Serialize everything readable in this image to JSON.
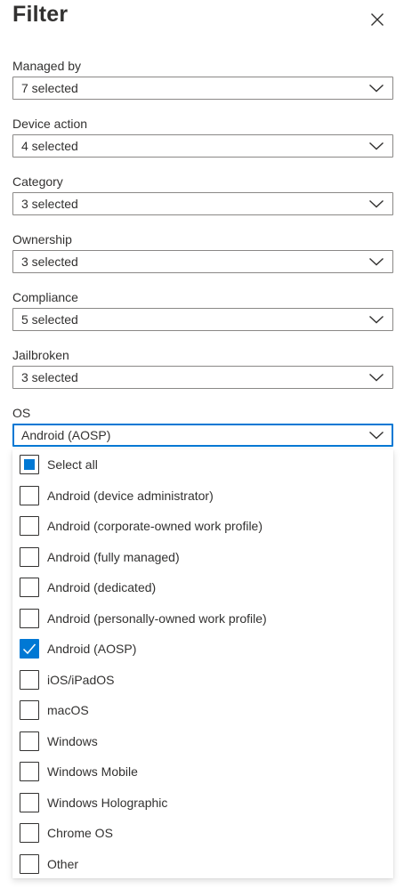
{
  "panel": {
    "title": "Filter",
    "close_icon": "close-icon"
  },
  "fields": [
    {
      "label": "Managed by",
      "value": "7 selected"
    },
    {
      "label": "Device action",
      "value": "4 selected"
    },
    {
      "label": "Category",
      "value": "3 selected"
    },
    {
      "label": "Ownership",
      "value": "3 selected"
    },
    {
      "label": "Compliance",
      "value": "5 selected"
    },
    {
      "label": "Jailbroken",
      "value": "3 selected"
    },
    {
      "label": "OS",
      "value": "Android (AOSP)",
      "open": true
    }
  ],
  "os_options": [
    {
      "label": "Select all",
      "state": "indeterminate"
    },
    {
      "label": "Android (device administrator)",
      "state": "unchecked"
    },
    {
      "label": "Android (corporate-owned work profile)",
      "state": "unchecked"
    },
    {
      "label": "Android (fully managed)",
      "state": "unchecked"
    },
    {
      "label": "Android (dedicated)",
      "state": "unchecked"
    },
    {
      "label": "Android (personally-owned work profile)",
      "state": "unchecked"
    },
    {
      "label": "Android (AOSP)",
      "state": "checked"
    },
    {
      "label": "iOS/iPadOS",
      "state": "unchecked"
    },
    {
      "label": "macOS",
      "state": "unchecked"
    },
    {
      "label": "Windows",
      "state": "unchecked"
    },
    {
      "label": "Windows Mobile",
      "state": "unchecked"
    },
    {
      "label": "Windows Holographic",
      "state": "unchecked"
    },
    {
      "label": "Chrome OS",
      "state": "unchecked"
    },
    {
      "label": "Other",
      "state": "unchecked"
    }
  ],
  "colors": {
    "accent": "#0078d4",
    "text": "#323130",
    "border": "#8a8886"
  }
}
